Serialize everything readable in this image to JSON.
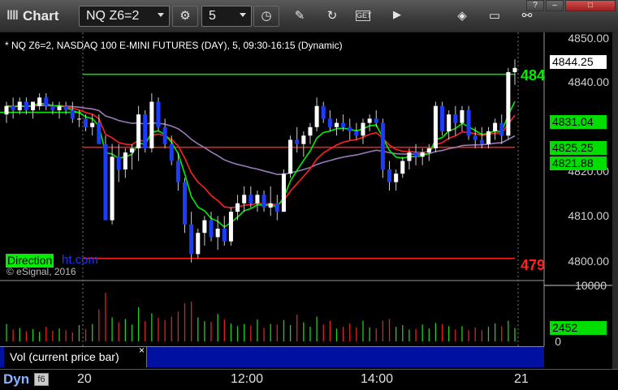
{
  "window": {
    "app_icon": "ǁǁ",
    "title": "Chart",
    "controls": [
      "?",
      "–",
      "□"
    ]
  },
  "toolbar": {
    "symbol": "NQ Z6=2",
    "interval": "5",
    "buttons": [
      {
        "name": "symbol-settings-icon",
        "glyph": "⚙"
      },
      {
        "name": "clock-icon",
        "glyph": "◷"
      }
    ],
    "tools": [
      {
        "name": "pencil-icon",
        "glyph": "✎"
      },
      {
        "name": "refresh-icon",
        "glyph": "↻"
      },
      {
        "name": "get-icon",
        "glyph": "GET"
      },
      {
        "name": "play-icon",
        "glyph": "▶"
      },
      {
        "name": "tag-icon",
        "glyph": "◈"
      },
      {
        "name": "message-icon",
        "glyph": "▭"
      },
      {
        "name": "link-icon",
        "glyph": "⚯"
      }
    ]
  },
  "chart": {
    "subtitle": "* NQ Z6=2, NASDAQ 100 E-MINI FUTURES (DAY), 5, 09:30-16:15 (Dynamic)",
    "watermark_green": "Direction",
    "watermark_blue": "ht.com",
    "copyright": "© eSignal, 2016",
    "price_axis": [
      "4850.00",
      "4840.00",
      "4810.00",
      "4800.00",
      "4820.00"
    ],
    "tags": [
      {
        "value": "4844.25",
        "bg": "#ffffff",
        "fg": "#000000"
      },
      {
        "value": "4831.04",
        "bg": "#00dd00",
        "fg": "#000000"
      },
      {
        "value": "4825.25",
        "bg": "#00dd00",
        "fg": "#000000"
      },
      {
        "value": "4821.88",
        "bg": "#00dd00",
        "fg": "#000000"
      }
    ],
    "line_labels": [
      {
        "text": "484",
        "color": "#00ee00"
      },
      {
        "text": "479",
        "color": "#ff2222"
      }
    ],
    "time_axis": [
      "20",
      "12:00",
      "14:00",
      "21"
    ],
    "colors": {
      "up_candle": "#ffffff",
      "down_candle": "#1a3cff",
      "ema_fast": "#00ee00",
      "ema_slow": "#ff2020",
      "ma_long": "#9a7ab8",
      "level_green": "#00ee00",
      "level_red": "#ff2020"
    }
  },
  "volume": {
    "panel_label": "Vol (current price bar)",
    "close_glyph": "×",
    "axis_top": "10000",
    "axis_bottom": "0",
    "current_value": "2452"
  },
  "bottom": {
    "label": "Dyn",
    "icon": "f6"
  },
  "chart_data": {
    "type": "candlestick",
    "y_range": [
      4797,
      4852
    ],
    "ohlc": [
      [
        4833,
        4836,
        4831,
        4835
      ],
      [
        4835,
        4837,
        4832,
        4834
      ],
      [
        4834,
        4837,
        4833,
        4836
      ],
      [
        4836,
        4837,
        4833,
        4834
      ],
      [
        4834,
        4836,
        4832,
        4836
      ],
      [
        4835,
        4838,
        4834,
        4837
      ],
      [
        4837,
        4838,
        4834,
        4835
      ],
      [
        4835,
        4836,
        4833,
        4834
      ],
      [
        4834,
        4836,
        4832,
        4835
      ],
      [
        4835,
        4836,
        4833,
        4834
      ],
      [
        4834,
        4836,
        4831,
        4832
      ],
      [
        4832,
        4834,
        4830,
        4832
      ],
      [
        4832,
        4833,
        4829,
        4830
      ],
      [
        4830,
        4833,
        4828,
        4831
      ],
      [
        4831,
        4833,
        4826,
        4826
      ],
      [
        4826,
        4828,
        4808,
        4808
      ],
      [
        4808,
        4826,
        4807,
        4823
      ],
      [
        4823,
        4826,
        4817,
        4820
      ],
      [
        4820,
        4825,
        4818,
        4824
      ],
      [
        4824,
        4826,
        4820,
        4825
      ],
      [
        4825,
        4835,
        4822,
        4833
      ],
      [
        4833,
        4834,
        4824,
        4825
      ],
      [
        4825,
        4838,
        4824,
        4836
      ],
      [
        4836,
        4837,
        4829,
        4830
      ],
      [
        4830,
        4832,
        4825,
        4826
      ],
      [
        4826,
        4828,
        4821,
        4822
      ],
      [
        4822,
        4824,
        4815,
        4817
      ],
      [
        4817,
        4818,
        4805,
        4807
      ],
      [
        4807,
        4810,
        4798,
        4800
      ],
      [
        4800,
        4806,
        4799,
        4805
      ],
      [
        4805,
        4809,
        4802,
        4808
      ],
      [
        4808,
        4810,
        4803,
        4804
      ],
      [
        4804,
        4809,
        4801,
        4806
      ],
      [
        4806,
        4809,
        4802,
        4803
      ],
      [
        4803,
        4811,
        4802,
        4810
      ],
      [
        4810,
        4814,
        4808,
        4812
      ],
      [
        4812,
        4816,
        4810,
        4814
      ],
      [
        4814,
        4816,
        4811,
        4812
      ],
      [
        4812,
        4815,
        4810,
        4814
      ],
      [
        4814,
        4815,
        4810,
        4811
      ],
      [
        4811,
        4816,
        4809,
        4812
      ],
      [
        4812,
        4814,
        4808,
        4810
      ],
      [
        4810,
        4820,
        4810,
        4819
      ],
      [
        4819,
        4828,
        4818,
        4827
      ],
      [
        4827,
        4830,
        4824,
        4826
      ],
      [
        4826,
        4829,
        4823,
        4828
      ],
      [
        4828,
        4831,
        4826,
        4830
      ],
      [
        4830,
        4837,
        4829,
        4835
      ],
      [
        4835,
        4836,
        4831,
        4832
      ],
      [
        4832,
        4834,
        4829,
        4830
      ],
      [
        4830,
        4832,
        4828,
        4831
      ],
      [
        4831,
        4833,
        4829,
        4830
      ],
      [
        4830,
        4832,
        4827,
        4829
      ],
      [
        4829,
        4831,
        4827,
        4828
      ],
      [
        4828,
        4832,
        4826,
        4831
      ],
      [
        4831,
        4833,
        4829,
        4832
      ],
      [
        4832,
        4834,
        4830,
        4831
      ],
      [
        4831,
        4832,
        4818,
        4820
      ],
      [
        4820,
        4822,
        4815,
        4817
      ],
      [
        4817,
        4820,
        4815,
        4819
      ],
      [
        4819,
        4823,
        4818,
        4822
      ],
      [
        4822,
        4825,
        4820,
        4824
      ],
      [
        4824,
        4826,
        4821,
        4823
      ],
      [
        4823,
        4825,
        4821,
        4824
      ],
      [
        4824,
        4826,
        4822,
        4825
      ],
      [
        4825,
        4836,
        4824,
        4835
      ],
      [
        4835,
        4836,
        4828,
        4829
      ],
      [
        4829,
        4834,
        4827,
        4833
      ],
      [
        4833,
        4835,
        4828,
        4831
      ],
      [
        4831,
        4835,
        4829,
        4834
      ],
      [
        4834,
        4835,
        4827,
        4828
      ],
      [
        4828,
        4830,
        4825,
        4827
      ],
      [
        4827,
        4830,
        4825,
        4826
      ],
      [
        4826,
        4830,
        4825,
        4829
      ],
      [
        4829,
        4832,
        4827,
        4831
      ],
      [
        4831,
        4833,
        4826,
        4828
      ],
      [
        4828,
        4844,
        4827,
        4843
      ],
      [
        4843,
        4846,
        4840,
        4844
      ]
    ],
    "volume": [
      3100,
      2100,
      2400,
      1800,
      2200,
      1700,
      2600,
      1900,
      2300,
      2000,
      1600,
      2900,
      2200,
      3100,
      5700,
      8700,
      4300,
      3400,
      4000,
      3000,
      6100,
      3600,
      5000,
      4200,
      3800,
      4400,
      5300,
      6800,
      7100,
      4300,
      3600,
      3500,
      4900,
      3900,
      3200,
      2700,
      3100,
      2800,
      3900,
      2400,
      3100,
      3000,
      3800,
      2900,
      4800,
      3400,
      2600,
      4400,
      3000,
      3700,
      2300,
      2600,
      3200,
      2500,
      3700,
      2500,
      2300,
      3700,
      4000,
      2600,
      2900,
      2100,
      2200,
      3000,
      2300,
      3300,
      3100,
      2700,
      2100,
      2700,
      2000,
      2500,
      2000,
      2600,
      3200,
      2700,
      3700,
      2400
    ],
    "levels": [
      {
        "price": 4842.5,
        "color": "green"
      },
      {
        "price": 4825.25,
        "color": "red"
      },
      {
        "price": 4799.0,
        "color": "red"
      }
    ]
  }
}
